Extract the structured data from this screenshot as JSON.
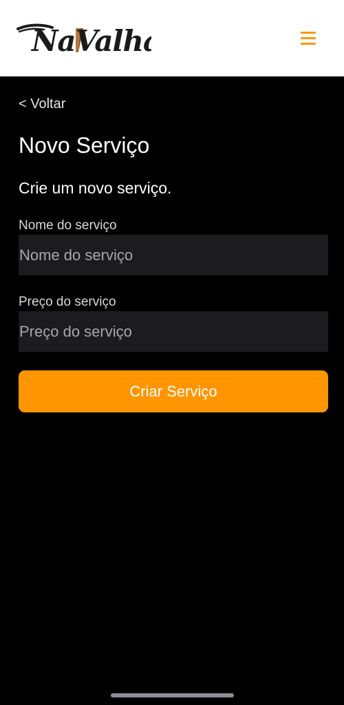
{
  "header": {
    "logo_text": "NaValha",
    "menu_icon": "hamburger-menu-icon",
    "accent_color": "#ff9500",
    "background_color": "#ffffff"
  },
  "nav": {
    "back_label": "< Voltar"
  },
  "main": {
    "title": "Novo Serviço",
    "subtitle": "Crie um novo serviço.",
    "background_color": "#000000"
  },
  "form": {
    "name_label": "Nome do serviço",
    "name_placeholder": "Nome do serviço",
    "name_value": "",
    "price_label": "Preço do serviço",
    "price_placeholder": "Preço do serviço",
    "price_value": "",
    "submit_label": "Criar Serviço",
    "field_background": "#1c1c1e",
    "button_color": "#ff9500"
  }
}
